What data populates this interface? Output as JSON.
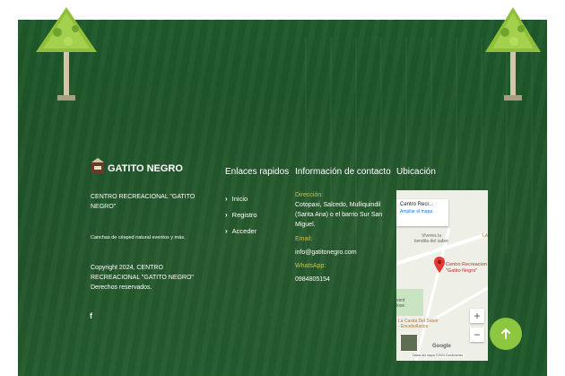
{
  "brand": {
    "name": "GATITO NEGRO"
  },
  "about": {
    "line1": "CENTRO RECREACIONAL \"GATITO",
    "line2": "NEGRO\"",
    "tagline": "Canchas de césped natural eventos y más.",
    "copy1": "Copyright 2024, CENTRO",
    "copy2": "RECREACIONAL \"GATITO NEGRO\"",
    "copy3": "Derechos reservados.",
    "social_icon": "facebook-icon"
  },
  "links": {
    "title": "Enlaces rapidos",
    "items": [
      {
        "label": "Inicio"
      },
      {
        "label": "Registro"
      },
      {
        "label": "Acceder"
      }
    ]
  },
  "contact": {
    "title": "Información de contacto",
    "address_label": "Dirección:",
    "address1": "Cotopaxi, Salcedo, Mulliquindil",
    "address2": "(Santa Ana) o el barrio Sur San",
    "address3": "Miguel.",
    "email_label": "Email:",
    "email": "info@gatitonegro.com",
    "whatsapp_label": "WhatsApp:",
    "whatsapp": "0984805154"
  },
  "location": {
    "title": "Ubicación",
    "map": {
      "card_title": "Centro Recr...",
      "card_link": "Ampliar el mapa",
      "pin_label1": "Centro Recreacion",
      "pin_label2": "\"Gatito Negro\"",
      "place1a": "Viveres la",
      "place1b": "tiendita del sabor",
      "place2a": "La Casita Del Sabor",
      "place2b": "- Encebollados",
      "edge1": "LA",
      "edge2a": "vent",
      "edge2b": "lose",
      "google": "Google",
      "footer": "Datos del mapa ©2024   Condiciones",
      "zoom_in": "+",
      "zoom_out": "−"
    }
  },
  "colors": {
    "bg": "#1d5328",
    "accent": "#8dc63f",
    "label": "#c8c25a"
  }
}
